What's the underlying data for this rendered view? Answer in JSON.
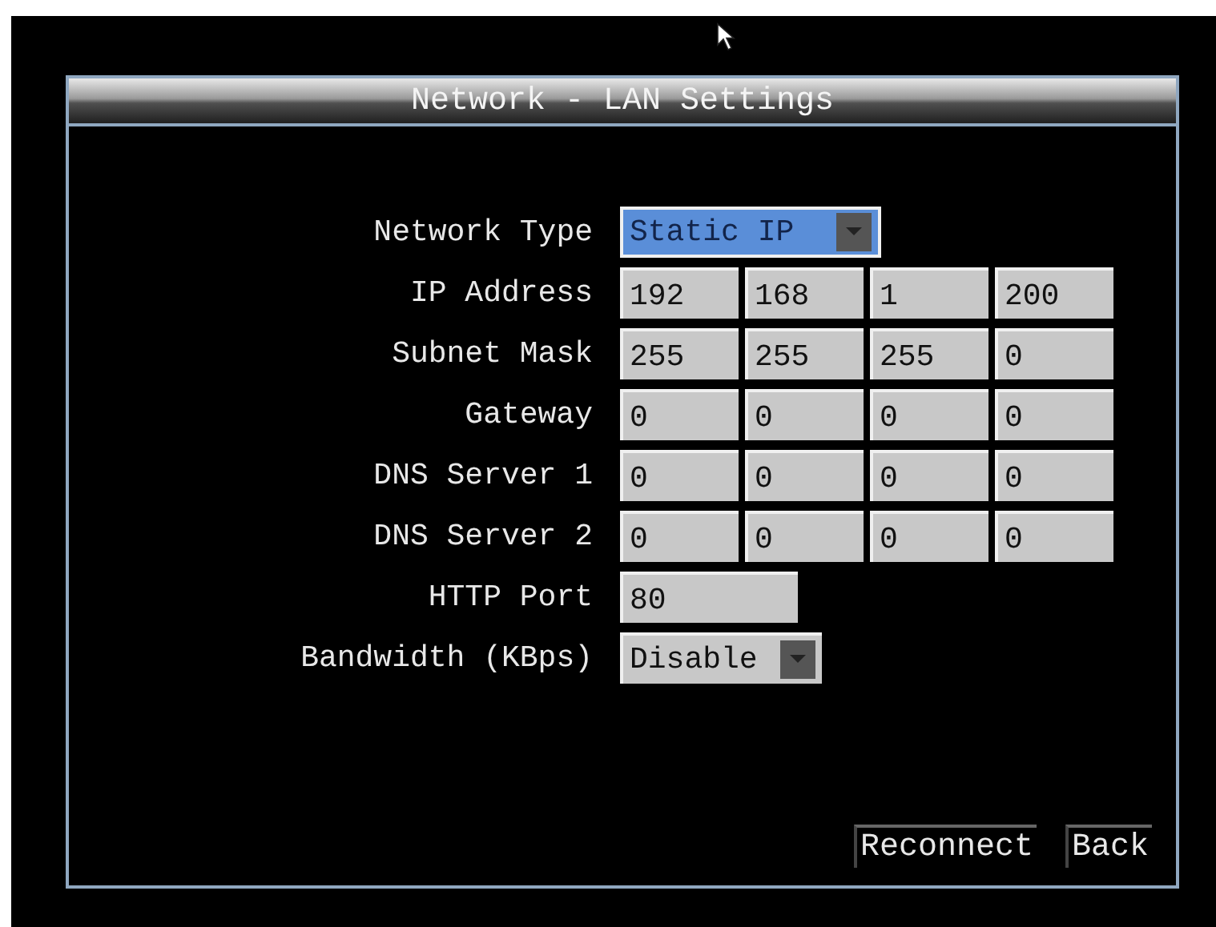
{
  "window": {
    "title": "Network - LAN Settings"
  },
  "rows": [
    {
      "kind": "dropdown",
      "label": "Network Type",
      "value": "Static IP",
      "focused": true
    },
    {
      "kind": "octets",
      "label": "IP Address",
      "values": [
        "192",
        "168",
        "1",
        "200"
      ]
    },
    {
      "kind": "octets",
      "label": "Subnet Mask",
      "values": [
        "255",
        "255",
        "255",
        "0"
      ]
    },
    {
      "kind": "octets",
      "label": "Gateway",
      "values": [
        "0",
        "0",
        "0",
        "0"
      ]
    },
    {
      "kind": "octets",
      "label": "DNS Server 1",
      "values": [
        "0",
        "0",
        "0",
        "0"
      ]
    },
    {
      "kind": "octets",
      "label": "DNS Server 2",
      "values": [
        "0",
        "0",
        "0",
        "0"
      ]
    },
    {
      "kind": "text",
      "label": "HTTP Port",
      "value": "80"
    },
    {
      "kind": "dropdown",
      "label": "Bandwidth (KBps)",
      "value": "Disable",
      "focused": false
    }
  ],
  "buttons": [
    "Reconnect",
    "Back"
  ]
}
